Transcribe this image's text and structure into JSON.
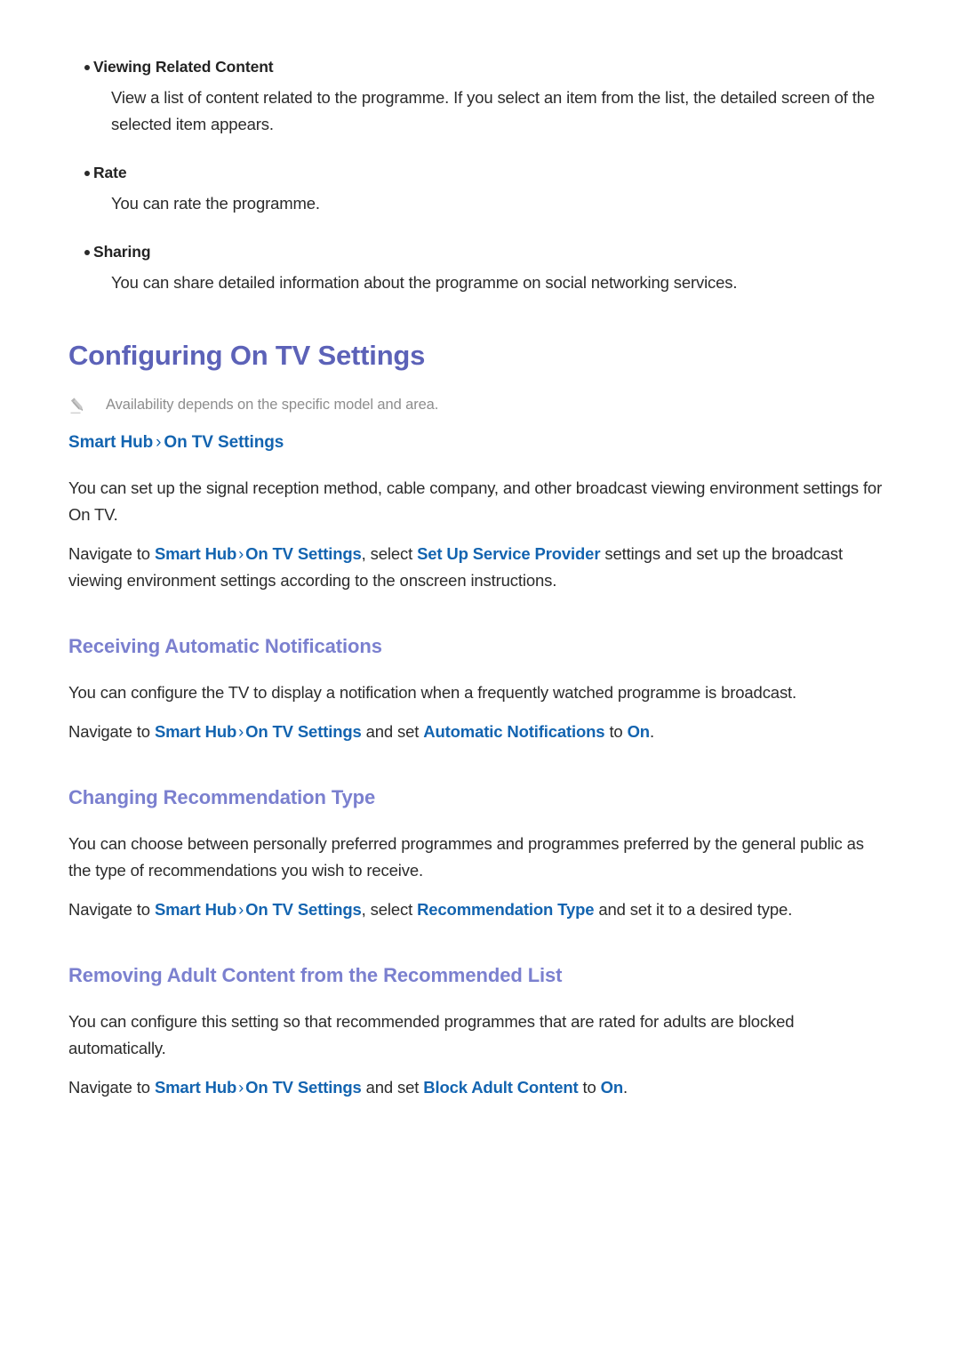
{
  "document": {
    "bullets": [
      {
        "label": "Viewing Related Content",
        "body": "View a list of content related to the programme. If you select an item from the list, the detailed screen of the selected item appears."
      },
      {
        "label": "Rate",
        "body": "You can rate the programme."
      },
      {
        "label": "Sharing",
        "body": "You can share detailed information about the programme on social networking services."
      }
    ],
    "main_heading": "Configuring On TV Settings",
    "note": {
      "icon": "pencil-icon",
      "text": "Availability depends on the specific model and area."
    },
    "path": {
      "first": "Smart Hub",
      "separator": "›",
      "second": "On TV Settings"
    },
    "intro": {
      "paragraph1": "You can set up the signal reception method, cable company, and other broadcast viewing environment settings for On TV.",
      "paragraph2": {
        "lead": "Navigate to ",
        "link1": "Smart Hub",
        "chevron": "›",
        "link2": "On TV Settings",
        "mid": ", select ",
        "link3": "Set Up Service Provider",
        "tail": " settings and set up the broadcast viewing environment settings according to the onscreen instructions."
      }
    },
    "sections": [
      {
        "heading": "Receiving Automatic Notifications",
        "paragraph": "You can configure the TV to display a notification when a frequently watched programme is broadcast.",
        "navigate": {
          "lead": "Navigate to ",
          "link1": "Smart Hub",
          "chevron": "›",
          "link2": "On TV Settings",
          "mid": " and set ",
          "link3": "Automatic Notifications",
          "mid2": " to ",
          "link4": "On",
          "tail": "."
        }
      },
      {
        "heading": "Changing Recommendation Type",
        "paragraph": "You can choose between personally preferred programmes and programmes preferred by the general public as the type of recommendations you wish to receive.",
        "navigate": {
          "lead": "Navigate to ",
          "link1": "Smart Hub",
          "chevron": "›",
          "link2": "On TV Settings",
          "mid": ", select ",
          "link3": "Recommendation Type",
          "mid2": " and set it to a desired type",
          "link4": "",
          "tail": "."
        }
      },
      {
        "heading": "Removing Adult Content from the Recommended List",
        "paragraph": "You can configure this setting so that recommended programmes that are rated for adults are blocked automatically.",
        "navigate": {
          "lead": "Navigate to ",
          "link1": "Smart Hub",
          "chevron": "›",
          "link2": "On TV Settings",
          "mid": " and set ",
          "link3": "Block Adult Content",
          "mid2": " to ",
          "link4": "On",
          "tail": "."
        }
      }
    ],
    "colors": {
      "main_heading": "#5c62b8",
      "sub_heading": "#7b80cf",
      "link": "#1364b0",
      "body_text": "#2b2b2b",
      "note_text": "#8d8d8d"
    }
  }
}
